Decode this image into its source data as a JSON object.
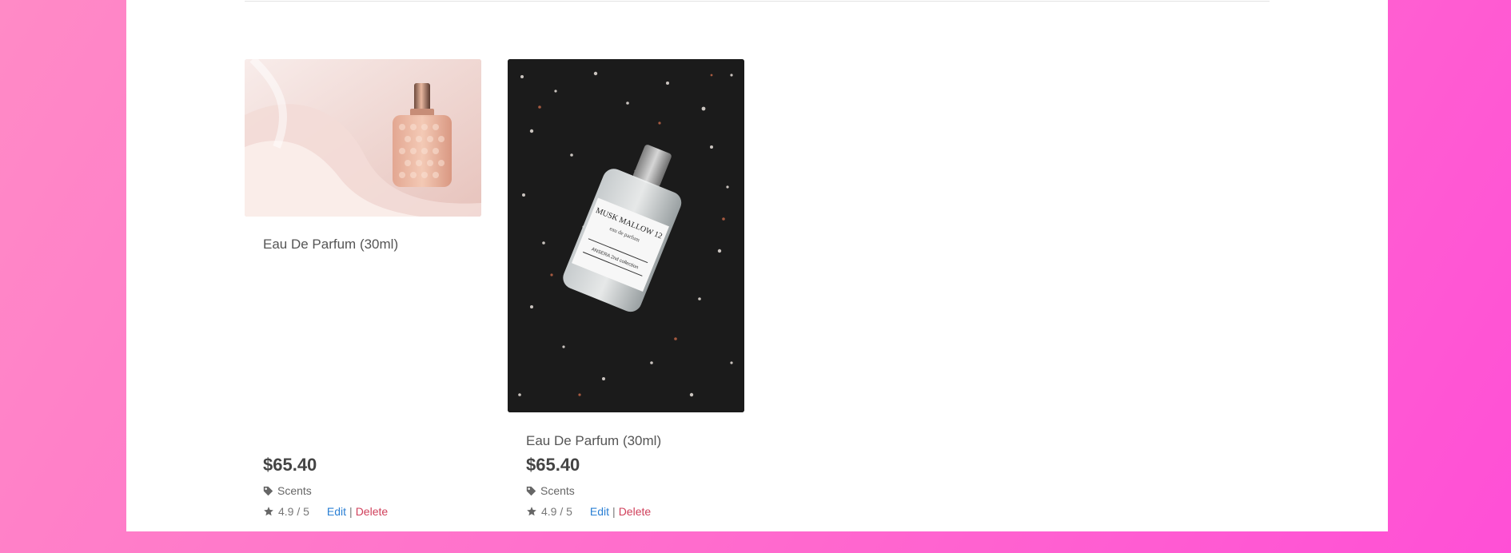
{
  "products": [
    {
      "title": "Eau De Parfum (30ml)",
      "price": "$65.40",
      "category": "Scents",
      "rating": "4.9 / 5",
      "edit_label": "Edit",
      "separator": "|",
      "delete_label": "Delete"
    },
    {
      "title": "Eau De Parfum (30ml)",
      "price": "$65.40",
      "category": "Scents",
      "rating": "4.9 / 5",
      "edit_label": "Edit",
      "separator": "|",
      "delete_label": "Delete",
      "label_lines": [
        "MUSK MALLOW 12",
        "eau de parfum",
        "ANSERA 2nd collection"
      ]
    }
  ],
  "colors": {
    "background_gradient_start": "#ff8ac6",
    "background_gradient_end": "#ff4fd6",
    "link": "#2a7fd4",
    "delete": "#d0405b"
  },
  "icons": {
    "category": "tag-icon",
    "rating": "star-icon"
  }
}
